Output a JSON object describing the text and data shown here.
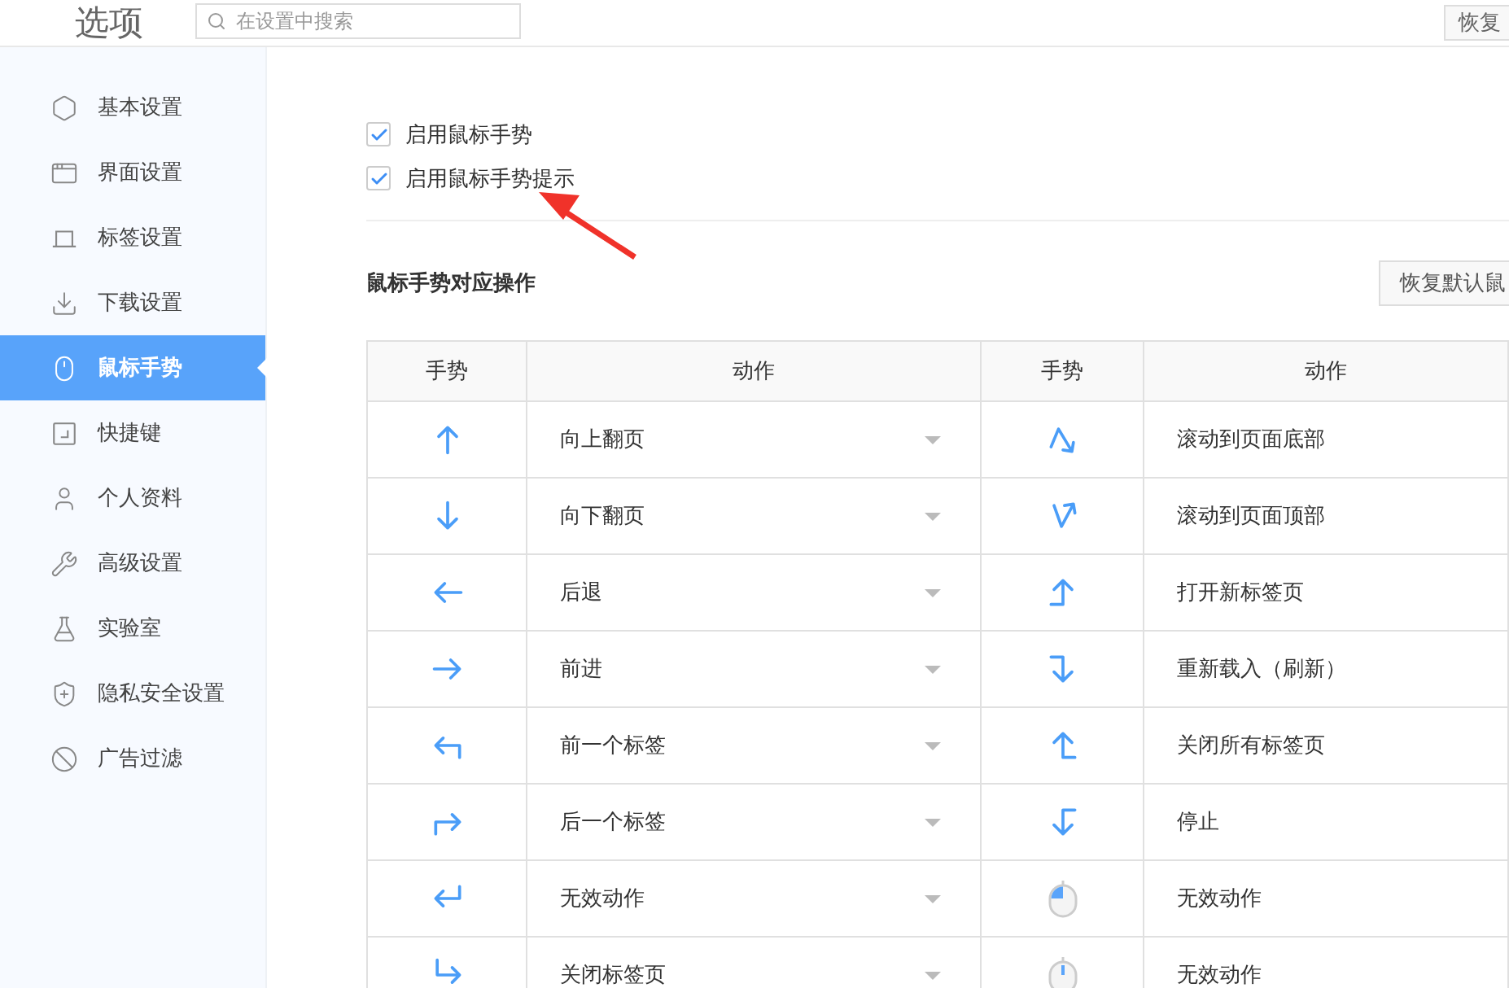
{
  "title": "选项",
  "search": {
    "placeholder": "在设置中搜索"
  },
  "top_button": "恢复",
  "sidebar": {
    "items": [
      {
        "label": "基本设置",
        "kind": "hexagon",
        "selected": false
      },
      {
        "label": "界面设置",
        "kind": "window",
        "selected": false
      },
      {
        "label": "标签设置",
        "kind": "tab",
        "selected": false
      },
      {
        "label": "下载设置",
        "kind": "download",
        "selected": false
      },
      {
        "label": "鼠标手势",
        "kind": "mouse",
        "selected": true
      },
      {
        "label": "快捷键",
        "kind": "shortcut",
        "selected": false
      },
      {
        "label": "个人资料",
        "kind": "user",
        "selected": false
      },
      {
        "label": "高级设置",
        "kind": "wrench",
        "selected": false
      },
      {
        "label": "实验室",
        "kind": "flask",
        "selected": false
      },
      {
        "label": "隐私安全设置",
        "kind": "shield",
        "selected": false
      },
      {
        "label": "广告过滤",
        "kind": "ban",
        "selected": false
      }
    ]
  },
  "options": [
    {
      "label": "启用鼠标手势",
      "checked": true
    },
    {
      "label": "启用鼠标手势提示",
      "checked": true
    }
  ],
  "section": {
    "title": "鼠标手势对应操作",
    "reset_button": "恢复默认鼠"
  },
  "table": {
    "columns": [
      "手势",
      "动作",
      "手势",
      "动作"
    ],
    "rows": [
      {
        "left": {
          "kind": "up",
          "action": "向上翻页"
        },
        "right": {
          "kind": "zigzag-down",
          "action": "滚动到页面底部"
        }
      },
      {
        "left": {
          "kind": "down",
          "action": "向下翻页"
        },
        "right": {
          "kind": "zigzag-up",
          "action": "滚动到页面顶部"
        }
      },
      {
        "left": {
          "kind": "left",
          "action": "后退"
        },
        "right": {
          "kind": "hook-up-right",
          "action": "打开新标签页"
        }
      },
      {
        "left": {
          "kind": "right",
          "action": "前进"
        },
        "right": {
          "kind": "hook-down-right",
          "action": "重新载入（刷新）"
        }
      },
      {
        "left": {
          "kind": "turn-left",
          "action": "前一个标签"
        },
        "right": {
          "kind": "hook-up-left",
          "action": "关闭所有标签页"
        }
      },
      {
        "left": {
          "kind": "turn-right",
          "action": "后一个标签"
        },
        "right": {
          "kind": "hook-down-left",
          "action": "停止"
        }
      },
      {
        "left": {
          "kind": "return-left",
          "action": "无效动作"
        },
        "right": {
          "kind": "mouse-left",
          "action": "无效动作"
        }
      },
      {
        "left": {
          "kind": "drop-right",
          "action": "关闭标签页"
        },
        "right": {
          "kind": "mouse-wheel",
          "action": "无效动作"
        }
      }
    ]
  }
}
